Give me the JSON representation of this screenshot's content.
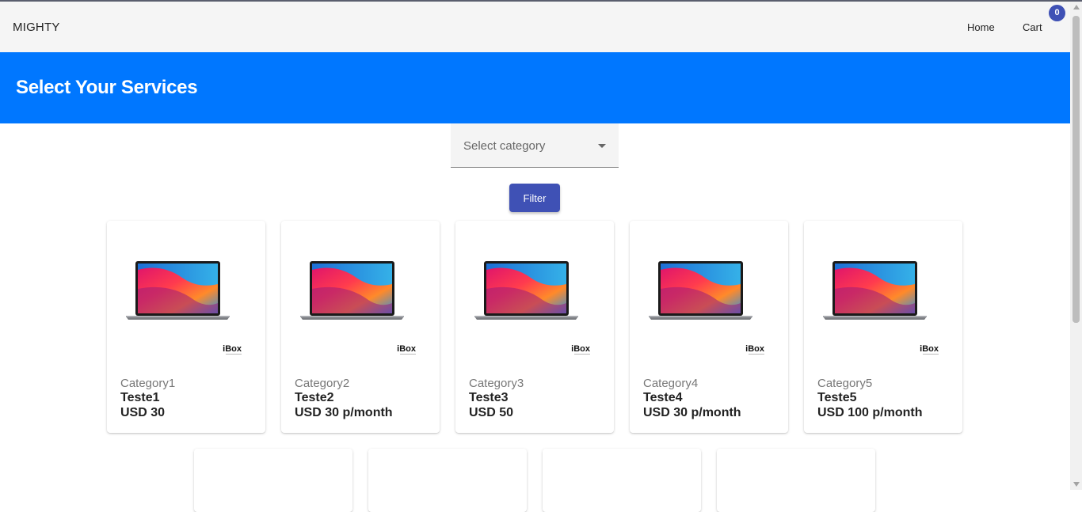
{
  "navbar": {
    "brand": "MIGHTY",
    "home_label": "Home",
    "cart_label": "Cart",
    "cart_count": "0"
  },
  "hero": {
    "title": "Select Your Services"
  },
  "filters": {
    "category_placeholder": "Select category",
    "filter_label": "Filter"
  },
  "products": [
    {
      "category": "Category1",
      "name": "Teste1",
      "price": "USD 30",
      "image_brand": "iBox"
    },
    {
      "category": "Category2",
      "name": "Teste2",
      "price": "USD 30 p/month",
      "image_brand": "iBox"
    },
    {
      "category": "Category3",
      "name": "Teste3",
      "price": "USD 50",
      "image_brand": "iBox"
    },
    {
      "category": "Category4",
      "name": "Teste4",
      "price": "USD 30 p/month",
      "image_brand": "iBox"
    },
    {
      "category": "Category5",
      "name": "Teste5",
      "price": "USD 100 p/month",
      "image_brand": "iBox"
    }
  ],
  "colors": {
    "hero_bg": "#0077ff",
    "primary": "#3f51b5",
    "navbar_bg": "#f5f5f5"
  },
  "icons": {
    "select_caret": "caret-down-icon",
    "scroll_up": "arrow-up-icon",
    "scroll_down": "arrow-down-icon"
  }
}
